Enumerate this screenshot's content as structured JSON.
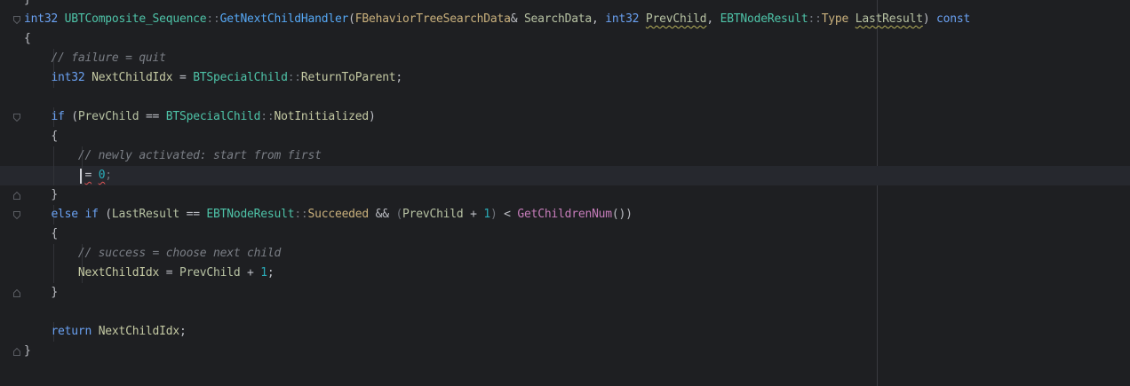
{
  "lines": [
    {
      "t": [
        {
          "c": "op",
          "v": "}"
        }
      ]
    },
    {
      "t": [
        {
          "c": "kw",
          "v": "int32"
        },
        {
          "c": "op",
          "v": " "
        },
        {
          "c": "cls",
          "v": "UBTComposite_Sequence"
        },
        {
          "c": "dim",
          "v": "::"
        },
        {
          "c": "fn",
          "v": "GetNextChildHandler"
        },
        {
          "c": "op",
          "v": "("
        },
        {
          "c": "mem",
          "v": "FBehaviorTreeSearchData"
        },
        {
          "c": "op",
          "v": "& "
        },
        {
          "c": "par",
          "v": "SearchData"
        },
        {
          "c": "op",
          "v": ", "
        },
        {
          "c": "kw",
          "v": "int32"
        },
        {
          "c": "op",
          "v": " "
        },
        {
          "c": "par",
          "v": "PrevChild",
          "sq": true
        },
        {
          "c": "op",
          "v": ", "
        },
        {
          "c": "cls",
          "v": "EBTNodeResult"
        },
        {
          "c": "dim",
          "v": "::"
        },
        {
          "c": "mem",
          "v": "Type"
        },
        {
          "c": "op",
          "v": " "
        },
        {
          "c": "par",
          "v": "LastResult",
          "sq": true
        },
        {
          "c": "op",
          "v": ") "
        },
        {
          "c": "kw",
          "v": "const"
        }
      ]
    },
    {
      "t": [
        {
          "c": "op",
          "v": "{"
        }
      ]
    },
    {
      "t": [
        {
          "c": "op",
          "v": "    "
        },
        {
          "c": "cmt",
          "v": "// failure = quit"
        }
      ]
    },
    {
      "t": [
        {
          "c": "op",
          "v": "    "
        },
        {
          "c": "kw",
          "v": "int32"
        },
        {
          "c": "op",
          "v": " "
        },
        {
          "c": "var",
          "v": "NextChildIdx"
        },
        {
          "c": "op",
          "v": " = "
        },
        {
          "c": "cls",
          "v": "BTSpecialChild"
        },
        {
          "c": "dim",
          "v": "::"
        },
        {
          "c": "var",
          "v": "ReturnToParent"
        },
        {
          "c": "op",
          "v": ";"
        }
      ]
    },
    {
      "t": []
    },
    {
      "t": [
        {
          "c": "op",
          "v": "    "
        },
        {
          "c": "kw",
          "v": "if"
        },
        {
          "c": "op",
          "v": " ("
        },
        {
          "c": "par",
          "v": "PrevChild"
        },
        {
          "c": "op",
          "v": " == "
        },
        {
          "c": "cls",
          "v": "BTSpecialChild"
        },
        {
          "c": "dim",
          "v": "::"
        },
        {
          "c": "var",
          "v": "NotInitialized"
        },
        {
          "c": "op",
          "v": ")"
        }
      ]
    },
    {
      "t": [
        {
          "c": "op",
          "v": "    {"
        }
      ]
    },
    {
      "t": [
        {
          "c": "op",
          "v": "        "
        },
        {
          "c": "cmt",
          "v": "// newly activated: start from first"
        }
      ]
    },
    {
      "t": [
        {
          "c": "op",
          "v": "        "
        },
        {
          "c": "op",
          "v": " ",
          "caret": true
        },
        {
          "c": "op",
          "v": "=",
          "err": true
        },
        {
          "c": "op",
          "v": " "
        },
        {
          "c": "num",
          "v": "0",
          "err": true
        },
        {
          "c": "dim",
          "v": ";"
        }
      ],
      "current": true
    },
    {
      "t": [
        {
          "c": "op",
          "v": "    }"
        }
      ]
    },
    {
      "t": [
        {
          "c": "op",
          "v": "    "
        },
        {
          "c": "kw",
          "v": "else if"
        },
        {
          "c": "op",
          "v": " ("
        },
        {
          "c": "par",
          "v": "LastResult"
        },
        {
          "c": "op",
          "v": " == "
        },
        {
          "c": "cls",
          "v": "EBTNodeResult"
        },
        {
          "c": "dim",
          "v": "::"
        },
        {
          "c": "mem",
          "v": "Succeeded"
        },
        {
          "c": "op",
          "v": " && "
        },
        {
          "c": "dim",
          "v": "("
        },
        {
          "c": "par",
          "v": "PrevChild"
        },
        {
          "c": "op",
          "v": " + "
        },
        {
          "c": "num",
          "v": "1"
        },
        {
          "c": "dim",
          "v": ")"
        },
        {
          "c": "op",
          "v": " < "
        },
        {
          "c": "fn2",
          "v": "GetChildrenNum"
        },
        {
          "c": "op",
          "v": "())"
        }
      ]
    },
    {
      "t": [
        {
          "c": "op",
          "v": "    {"
        }
      ]
    },
    {
      "t": [
        {
          "c": "op",
          "v": "        "
        },
        {
          "c": "cmt",
          "v": "// success = choose next child"
        }
      ]
    },
    {
      "t": [
        {
          "c": "op",
          "v": "        "
        },
        {
          "c": "var",
          "v": "NextChildIdx"
        },
        {
          "c": "op",
          "v": " = "
        },
        {
          "c": "par",
          "v": "PrevChild"
        },
        {
          "c": "op",
          "v": " + "
        },
        {
          "c": "num",
          "v": "1"
        },
        {
          "c": "op",
          "v": ";"
        }
      ]
    },
    {
      "t": [
        {
          "c": "op",
          "v": "    }"
        }
      ]
    },
    {
      "t": []
    },
    {
      "t": [
        {
          "c": "op",
          "v": "    "
        },
        {
          "c": "kw",
          "v": "return"
        },
        {
          "c": "op",
          "v": " "
        },
        {
          "c": "var",
          "v": "NextChildIdx"
        },
        {
          "c": "op",
          "v": ";"
        }
      ]
    },
    {
      "t": [
        {
          "c": "op",
          "v": "}"
        }
      ]
    }
  ],
  "folds": [
    {
      "line": 1,
      "icon": "fold-open-icon"
    },
    {
      "line": 6,
      "icon": "fold-open-icon"
    },
    {
      "line": 10,
      "icon": "fold-close-icon"
    },
    {
      "line": 11,
      "icon": "fold-open-icon"
    },
    {
      "line": 15,
      "icon": "fold-close-icon"
    },
    {
      "line": 18,
      "icon": "fold-close-icon"
    }
  ],
  "colors": {
    "background": "#1e1f22",
    "current_line": "#26282e",
    "keyword": "#6aa1f2",
    "function": "#56a8f5",
    "class": "#4ec3a8",
    "comment": "#7a7e85",
    "number": "#2aacb8",
    "error_squiggle": "#e05555",
    "warning_squiggle": "#b8b25a"
  }
}
